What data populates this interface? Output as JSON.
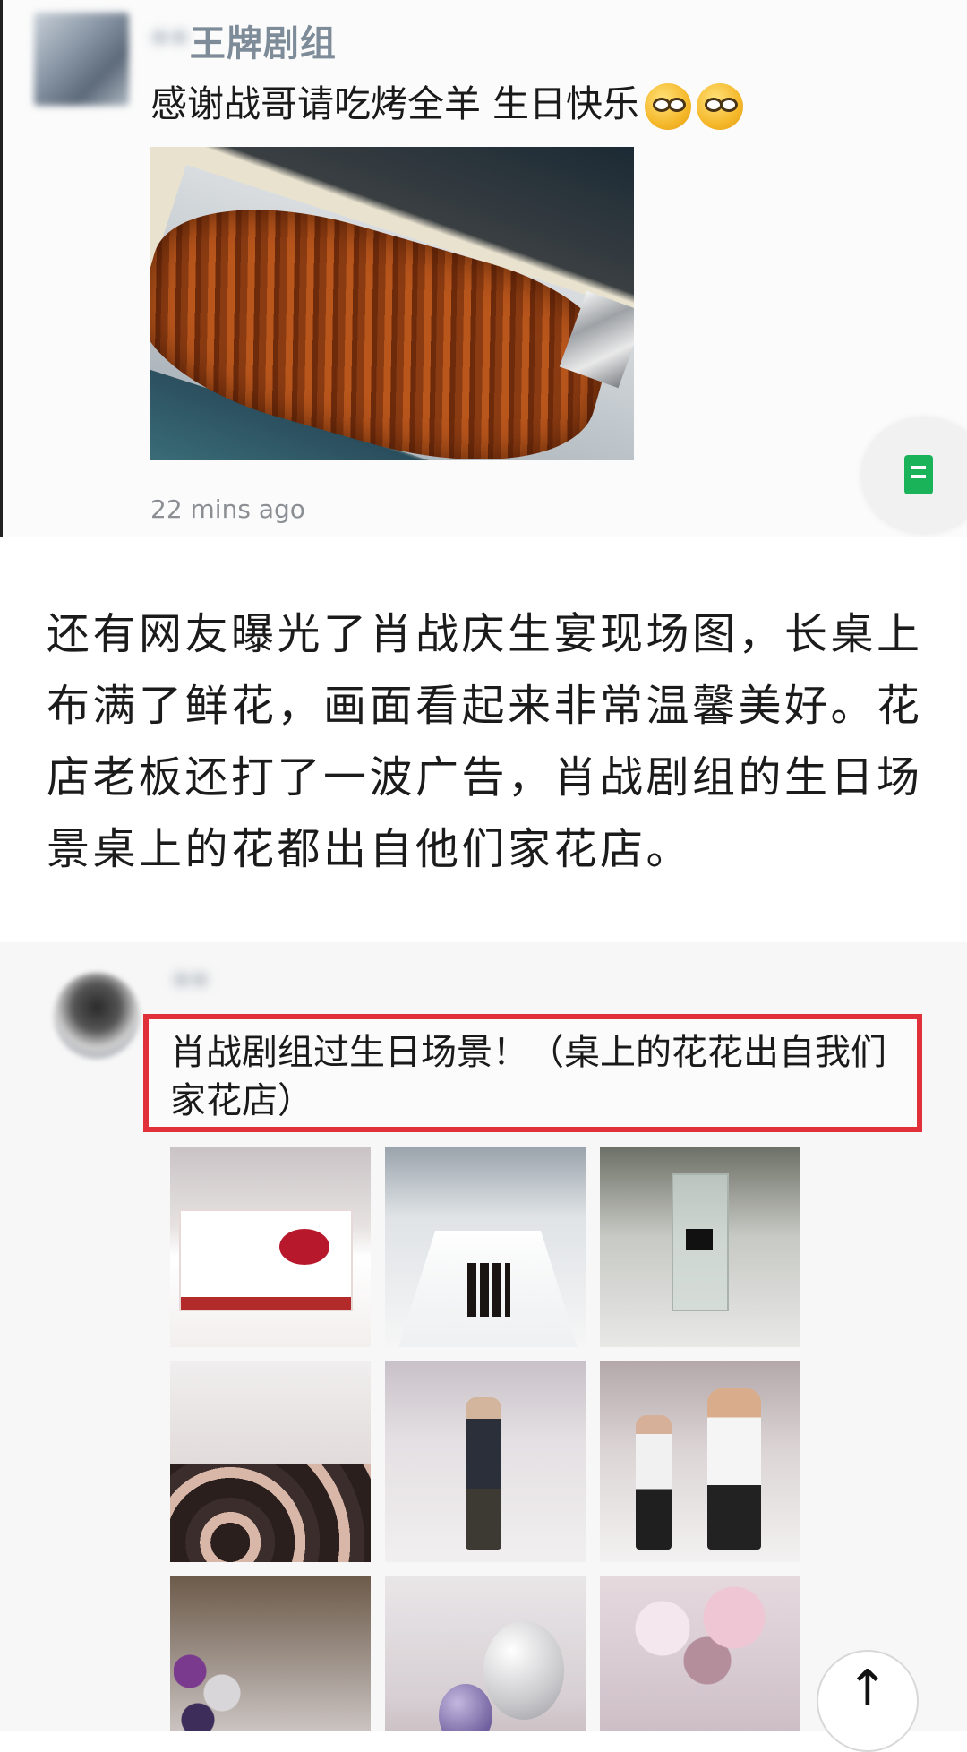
{
  "post1": {
    "username_visible": "王牌剧组",
    "username_blurred": "**",
    "message": "感谢战哥请吃烤全羊 生日快乐",
    "emoji": [
      "thinking-face-icon",
      "thinking-face-icon"
    ],
    "timestamp": "22 mins ago",
    "floating_button_icon": "document-icon"
  },
  "article": {
    "paragraph": "还有网友曝光了肖战庆生宴现场图，长桌上布满了鲜花，画面看起来非常温馨美好。花店老板还打了一波广告，肖战剧组的生日场景桌上的花都出自他们家花店。"
  },
  "post2": {
    "username_blurred": "**",
    "message": "肖战剧组过生日场景！（桌上的花花出自我们家花店）",
    "highlight_color": "#e0303a",
    "photos": [
      "cake",
      "long-table",
      "vase",
      "guests",
      "person-walking",
      "guests-walking",
      "balloons-left",
      "balloons",
      "flowers"
    ]
  },
  "to_top_button": {
    "glyph": "↑"
  }
}
